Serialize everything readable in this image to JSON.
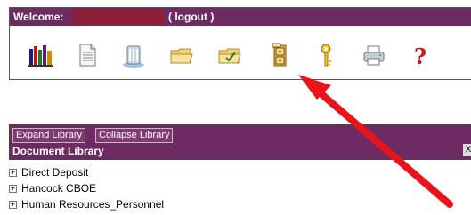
{
  "header": {
    "welcome": "Welcome:",
    "logout": "( logout )"
  },
  "toolbar": {
    "icons": [
      "books-icon",
      "document-icon",
      "server-icon",
      "folder-icon",
      "folder-check-icon",
      "file-cabinet-icon",
      "key-icon",
      "printer-icon",
      "help-icon"
    ]
  },
  "library": {
    "expand": "Expand Library",
    "collapse": "Collapse Library",
    "title": "Document Library",
    "close": "X",
    "items": [
      {
        "label": "Direct Deposit"
      },
      {
        "label": "Hancock CBOE"
      },
      {
        "label": "Human Resources_Personnel"
      }
    ]
  },
  "colors": {
    "header_bg": "#6e2a63",
    "username_bg": "#8e1f3a",
    "arrow": "#e8141c"
  }
}
